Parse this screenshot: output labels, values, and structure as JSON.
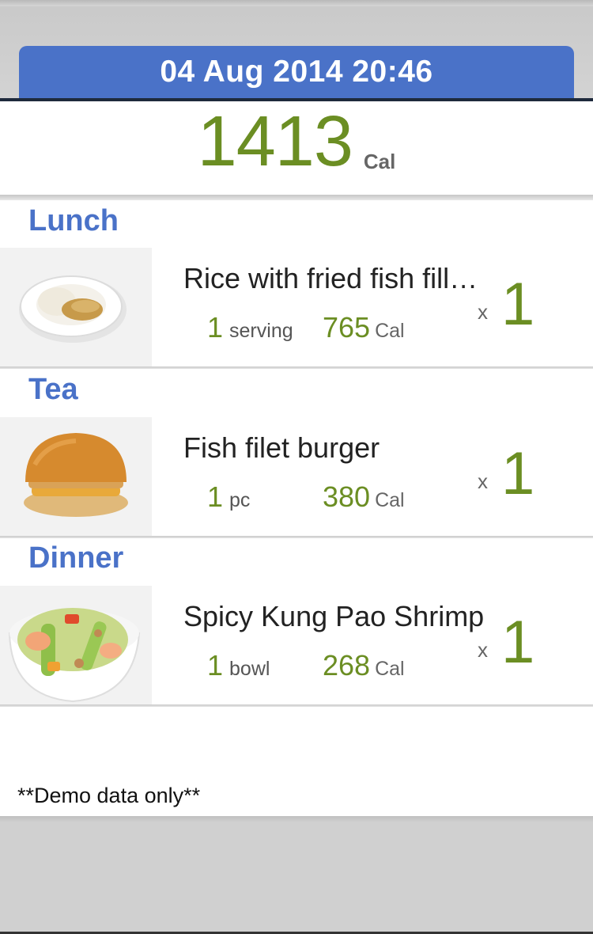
{
  "header": {
    "datetime": "04 Aug 2014 20:46"
  },
  "summary": {
    "total_calories": "1413",
    "unit": "Cal"
  },
  "meals": [
    {
      "label": "Lunch",
      "food": {
        "name": "Rice with fried fish fill…",
        "qty": "1",
        "unit": "serving",
        "calories": "765",
        "cal_unit": "Cal",
        "x": "x",
        "count": "1",
        "icon": "rice-fish-plate-photo"
      }
    },
    {
      "label": "Tea",
      "food": {
        "name": "Fish filet burger",
        "qty": "1",
        "unit": "pc",
        "calories": "380",
        "cal_unit": "Cal",
        "x": "x",
        "count": "1",
        "icon": "fish-burger-photo"
      }
    },
    {
      "label": "Dinner",
      "food": {
        "name": "Spicy Kung Pao Shrimp",
        "qty": "1",
        "unit": "bowl",
        "calories": "268",
        "cal_unit": "Cal",
        "x": "x",
        "count": "1",
        "icon": "kung-pao-shrimp-bowl-photo"
      }
    }
  ],
  "footer": {
    "note": "**Demo data only**"
  },
  "colors": {
    "accent_blue": "#4a72c8",
    "calorie_green": "#6b8e23"
  }
}
